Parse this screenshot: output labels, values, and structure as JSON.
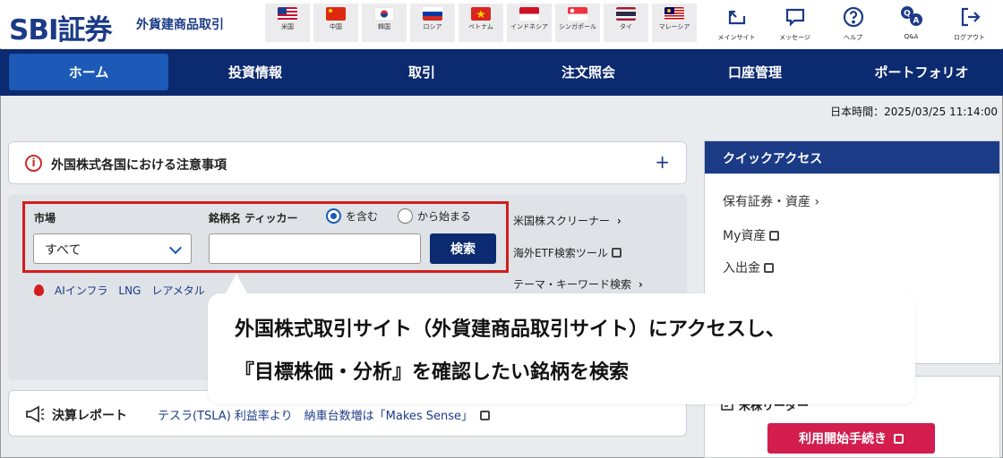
{
  "header": {
    "logo": "SBI証券",
    "subtitle": "外貨建商品取引",
    "countries": [
      {
        "label": "米国",
        "icon": "us-flag-icon"
      },
      {
        "label": "中国",
        "icon": "china-flag-icon"
      },
      {
        "label": "韓国",
        "icon": "korea-flag-icon"
      },
      {
        "label": "ロシア",
        "icon": "russia-flag-icon"
      },
      {
        "label": "ベトナム",
        "icon": "vietnam-flag-icon"
      },
      {
        "label": "インドネシア",
        "icon": "indonesia-flag-icon"
      },
      {
        "label": "シンガポール",
        "icon": "singapore-flag-icon"
      },
      {
        "label": "タイ",
        "icon": "thailand-flag-icon"
      },
      {
        "label": "マレーシア",
        "icon": "malaysia-flag-icon"
      }
    ],
    "tools": [
      {
        "label": "メインサイト",
        "icon": "main-site-icon"
      },
      {
        "label": "メッセージ",
        "icon": "message-icon"
      },
      {
        "label": "ヘルプ",
        "icon": "help-icon"
      },
      {
        "label": "Q&A",
        "icon": "qa-icon"
      },
      {
        "label": "ログアウト",
        "icon": "logout-icon"
      }
    ]
  },
  "nav": {
    "items": [
      "ホーム",
      "投資情報",
      "取引",
      "注文照会",
      "口座管理",
      "ポートフォリオ"
    ],
    "active": "ホーム"
  },
  "time": "日本時間：2025/03/25 11:14:00",
  "notice": {
    "text": "外国株式各国における注意事項",
    "icon": "warning-icon",
    "expand": "+"
  },
  "search": {
    "market_label": "市場",
    "market_value": "すべて",
    "ticker_label": "銘柄名 ティッカー",
    "radio_contains": "を含む",
    "radio_starts": "から始まる",
    "ticker_value": "",
    "button": "検索"
  },
  "side_links": [
    {
      "label": "米国株スクリーナー",
      "suffix": "›"
    },
    {
      "label": "海外ETF検索ツール",
      "suffix": "ext"
    },
    {
      "label": "テーマ・キーワード検索",
      "suffix": "›"
    }
  ],
  "trends": [
    "AIインフラ",
    "LNG",
    "レアメタル"
  ],
  "report": {
    "label": "決算レポート",
    "text": "テスラ(TSLA) 利益率より　納車台数増は「Makes Sense」"
  },
  "quick_access": {
    "title": "クイックアクセス",
    "links": [
      "保有証券・資産 ›",
      "My資産",
      "入出金"
    ]
  },
  "registration": {
    "title": "米株リーダー",
    "button": "利用開始手続き"
  },
  "callout": {
    "line1": "外国株式取引サイト（外貨建商品取引サイト）にアクセスし、",
    "line2": "『目標株価・分析』を確認したい銘柄を検索"
  },
  "colors": {
    "navy": "#0c2a6f",
    "brand": "#1b3b87",
    "highlight": "#d21d1d",
    "accent_red": "#d21d4e"
  }
}
